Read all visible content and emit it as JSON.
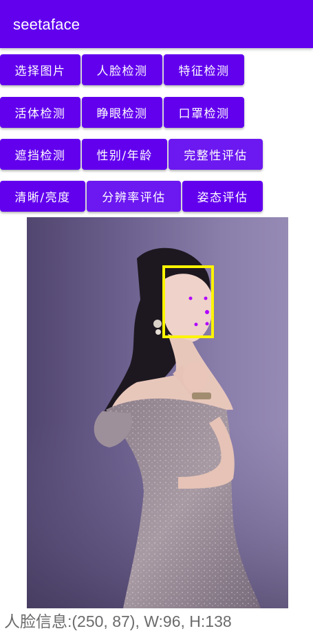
{
  "app": {
    "title": "seetaface"
  },
  "buttons": {
    "select_image": "选择图片",
    "face_detect": "人脸检测",
    "feature_detect": "特征检测",
    "liveness_detect": "活体检测",
    "eye_open_detect": "睁眼检测",
    "mask_detect": "口罩检测",
    "occlusion_detect": "遮挡检测",
    "gender_age": "性别/年龄",
    "integrity_eval": "完整性评估",
    "clarity_brightness": "清晰/亮度",
    "resolution_eval": "分辨率评估",
    "pose_eval": "姿态评估"
  },
  "result": {
    "info": "人脸信息:(250, 87), W:96, H:138"
  },
  "colors": {
    "primary": "#6200ee",
    "face_box": "#fcf401",
    "landmark": "#b000ff"
  }
}
